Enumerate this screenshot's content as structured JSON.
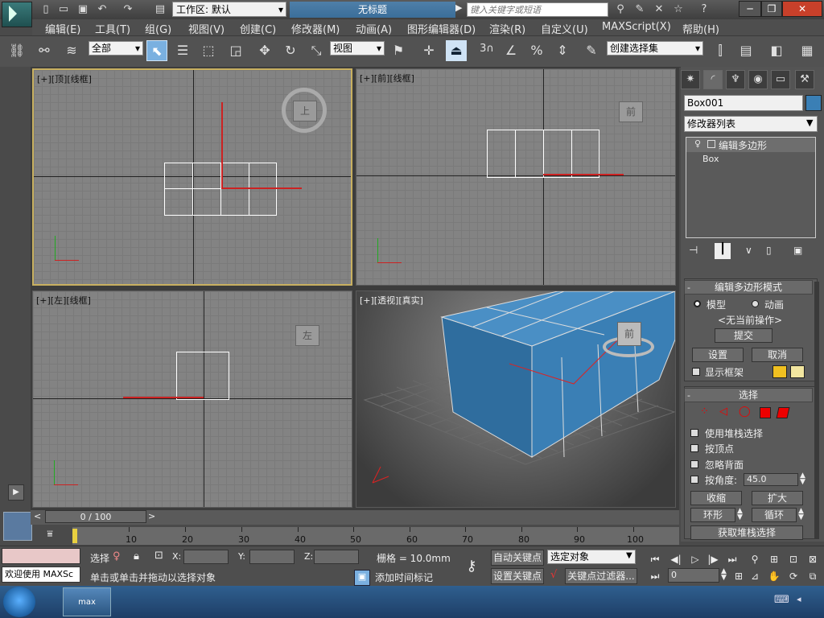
{
  "window": {
    "workspace_label": "工作区: 默认",
    "doc_title": "无标题",
    "search_placeholder": "键入关键字或短语"
  },
  "menu": [
    "编辑(E)",
    "工具(T)",
    "组(G)",
    "视图(V)",
    "创建(C)",
    "修改器(M)",
    "动画(A)",
    "图形编辑器(D)",
    "渲染(R)",
    "自定义(U)",
    "MAXScript(X)",
    "帮助(H)"
  ],
  "toolbar": {
    "selection_filter": "全部",
    "ref_coord": "视图",
    "named_selection": "创建选择集",
    "snap_label": "3"
  },
  "viewports": {
    "top": {
      "label": "[+][顶][线框]",
      "cube": "上"
    },
    "front": {
      "label": "[+][前][线框]",
      "cube": "前"
    },
    "left": {
      "label": "[+][左][线框]",
      "cube": "左"
    },
    "persp": {
      "label": "[+][透视][真实]",
      "cube": "前"
    }
  },
  "command_panel": {
    "object_name": "Box001",
    "modifier_list": "修改器列表",
    "stack": [
      "编辑多边形",
      "Box"
    ],
    "edit_poly_rollout": {
      "title": "编辑多边形模式",
      "mode_model": "模型",
      "mode_anim": "动画",
      "no_op": "<无当前操作>",
      "commit": "提交",
      "settings": "设置",
      "cancel": "取消",
      "show_cage": "显示框架"
    },
    "selection_rollout": {
      "title": "选择",
      "use_stack": "使用堆栈选择",
      "by_vertex": "按顶点",
      "ignore_back": "忽略背面",
      "by_angle": "按角度:",
      "angle_value": "45.0",
      "shrink": "收缩",
      "grow": "扩大",
      "ring": "环形",
      "loop": "循环",
      "get_stack": "获取堆栈选择"
    }
  },
  "timeline": {
    "slider": "0 / 100",
    "ticks": [
      "10",
      "20",
      "30",
      "40",
      "50",
      "60",
      "70",
      "80",
      "90",
      "100"
    ]
  },
  "status": {
    "welcome": "欢迎使用 MAXSc",
    "selected": "选择",
    "x_label": "X:",
    "y_label": "Y:",
    "z_label": "Z:",
    "grid": "栅格 = 10.0mm",
    "prompt": "单击或单击并拖动以选择对象",
    "add_time_tag": "添加时间标记",
    "auto_key": "自动关键点",
    "set_key": "设置关键点",
    "key_mode": "选定对象",
    "key_filters": "关键点过滤器...",
    "frame": "0"
  },
  "taskbar": {
    "max_label": "max"
  },
  "colors": {
    "accent": "#7ab0e0",
    "box_blue": "#3a7fb5",
    "swatch_yellow": "#f0c020",
    "swatch_cream": "#f2e6a0",
    "red": "#e00000"
  }
}
